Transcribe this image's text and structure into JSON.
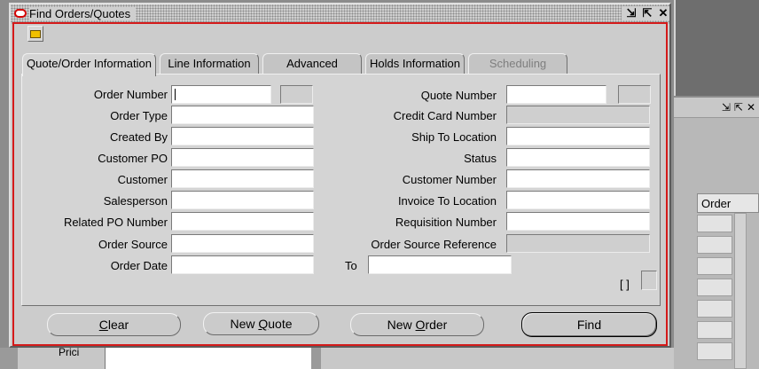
{
  "window": {
    "title": "Find Orders/Quotes",
    "controls": [
      "⇲",
      "⇱",
      "✕"
    ]
  },
  "tabs": [
    {
      "label": "Quote/Order Information",
      "state": "active"
    },
    {
      "label": "Line Information",
      "state": "normal"
    },
    {
      "label": "Advanced",
      "state": "normal"
    },
    {
      "label": "Holds Information",
      "state": "normal"
    },
    {
      "label": "Scheduling",
      "state": "disabled"
    }
  ],
  "left_fields": [
    {
      "label": "Order Number",
      "value": ""
    },
    {
      "label": "Order Type",
      "value": ""
    },
    {
      "label": "Created By",
      "value": ""
    },
    {
      "label": "Customer PO",
      "value": ""
    },
    {
      "label": "Customer",
      "value": ""
    },
    {
      "label": "Salesperson",
      "value": ""
    },
    {
      "label": "Related PO Number",
      "value": ""
    },
    {
      "label": "Order Source",
      "value": ""
    },
    {
      "label": "Order Date",
      "value": ""
    }
  ],
  "right_fields": [
    {
      "label": "Quote Number",
      "value": ""
    },
    {
      "label": "Credit Card Number",
      "value": ""
    },
    {
      "label": "Ship To Location",
      "value": ""
    },
    {
      "label": "Status",
      "value": ""
    },
    {
      "label": "Customer Number",
      "value": ""
    },
    {
      "label": "Invoice To Location",
      "value": ""
    },
    {
      "label": "Requisition Number",
      "value": ""
    },
    {
      "label": "Order Source Reference",
      "value": ""
    }
  ],
  "order_date_to": {
    "label": "To",
    "value": ""
  },
  "bracket_text": "[ ]",
  "buttons": {
    "clear": {
      "prefix": "",
      "mnemonic": "C",
      "rest": "lear"
    },
    "new_quote": {
      "prefix": "New ",
      "mnemonic": "Q",
      "rest": "uote"
    },
    "new_order": {
      "prefix": "New ",
      "mnemonic": "O",
      "rest": "rder"
    },
    "find": {
      "label": "Find"
    }
  },
  "background": {
    "grid_header": "Order",
    "partial_label": "Prici",
    "window_controls": [
      "⇲",
      "⇱",
      "✕"
    ]
  }
}
